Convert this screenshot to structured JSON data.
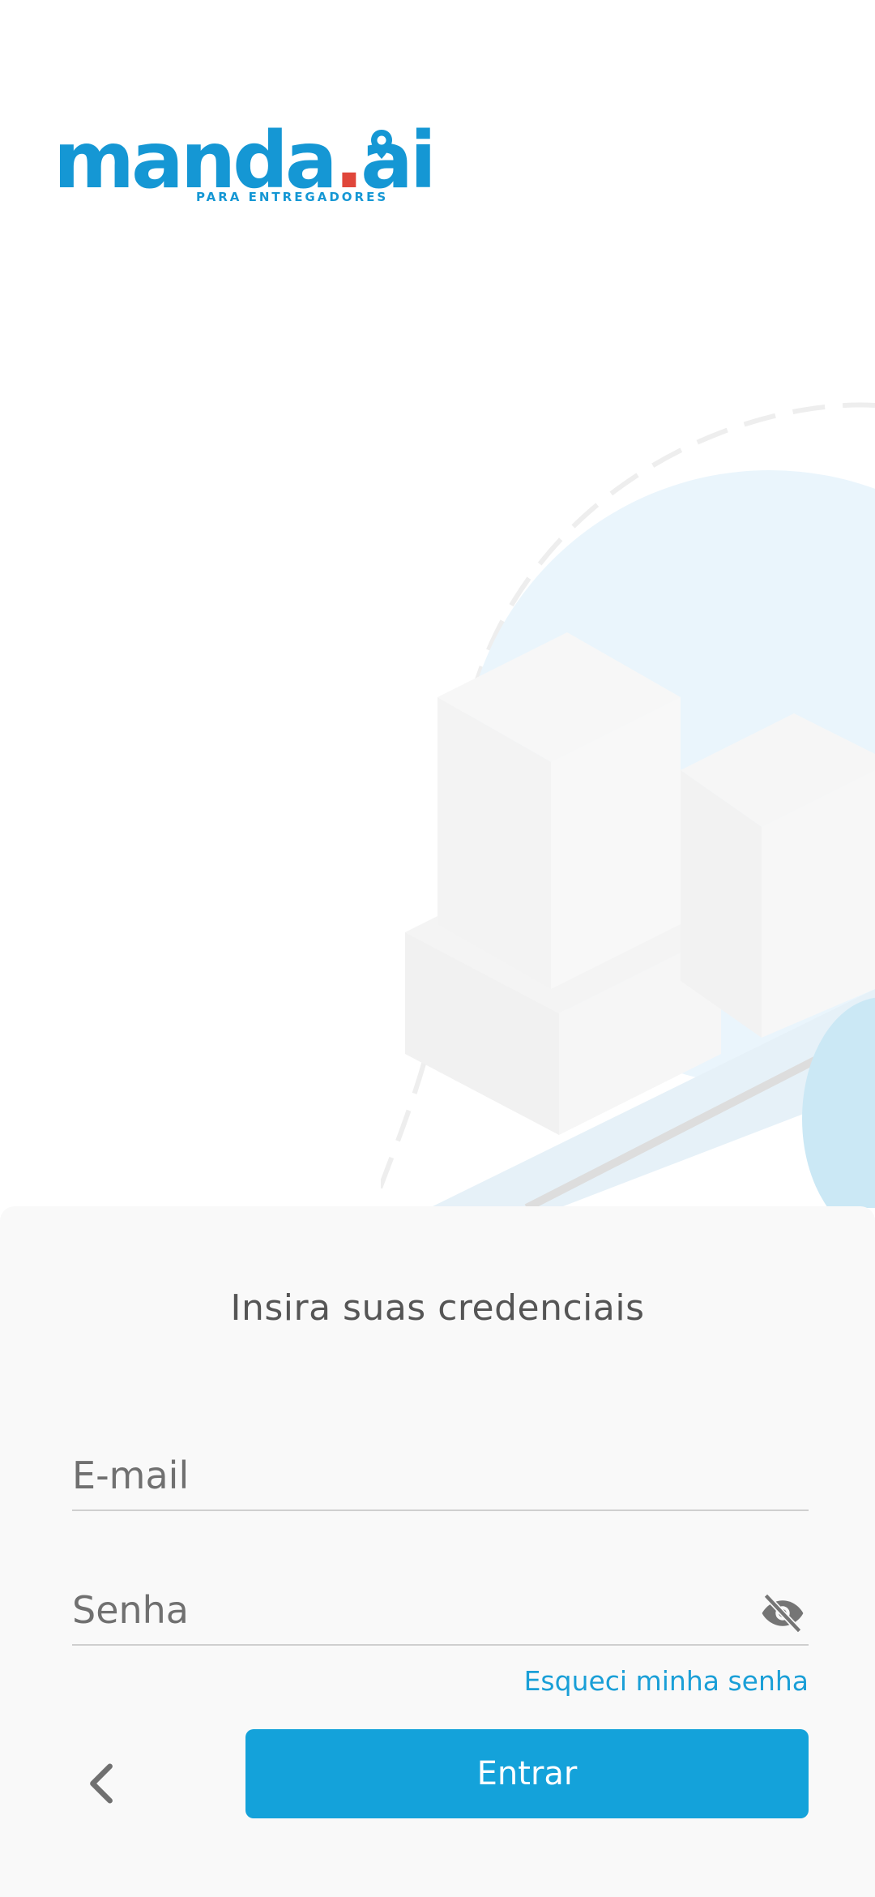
{
  "brand": {
    "name_part1": "manda",
    "name_dot": ".",
    "name_part2": "ai",
    "tagline": "PARA ENTREGADORES",
    "primary_color": "#1597d4",
    "accent_color": "#e0463a"
  },
  "login": {
    "title": "Insira suas credenciais",
    "email_placeholder": "E-mail",
    "password_placeholder": "Senha",
    "forgot_password": "Esqueci minha senha",
    "submit_label": "Entrar"
  },
  "icons": {
    "password_toggle": "eye-off-icon",
    "back": "chevron-left-icon"
  }
}
